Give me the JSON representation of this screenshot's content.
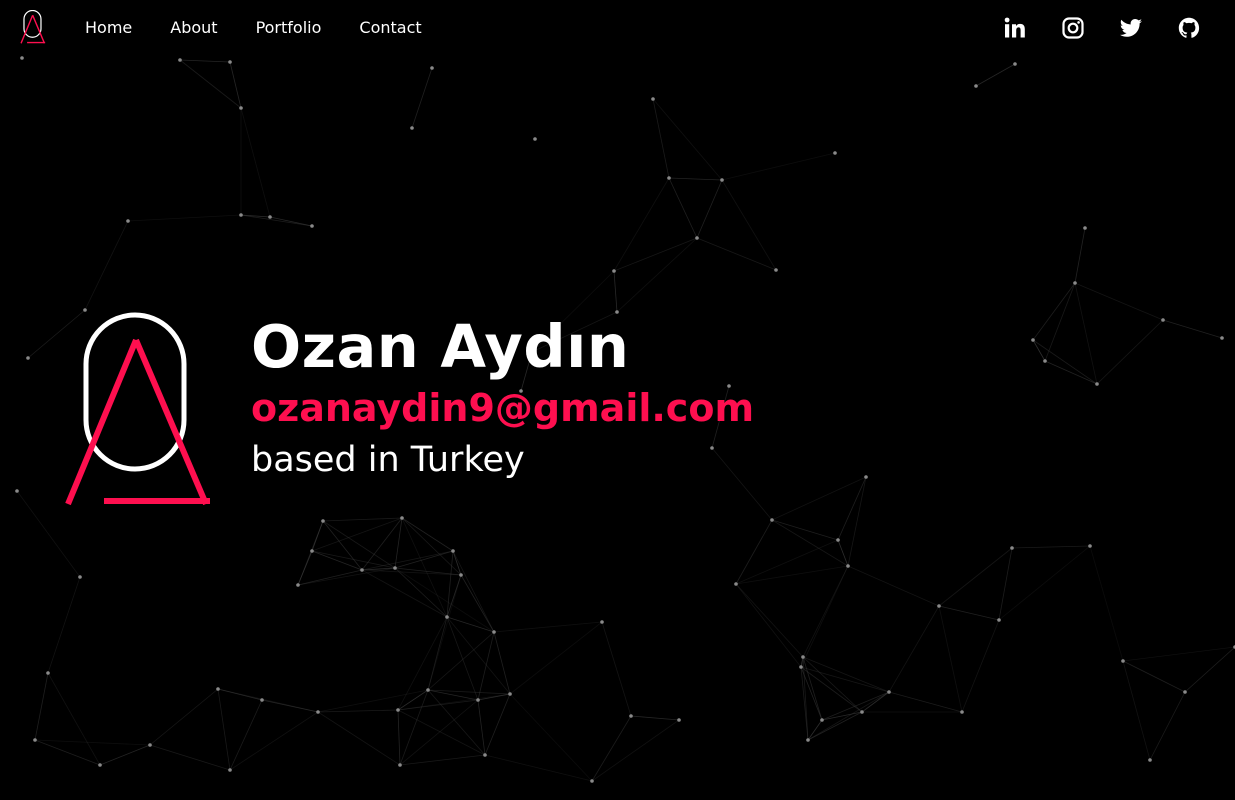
{
  "nav": {
    "logo_icon": "ozan-aydin-logo-icon",
    "links": [
      {
        "label": "Home"
      },
      {
        "label": "About"
      },
      {
        "label": "Portfolio"
      },
      {
        "label": "Contact"
      }
    ]
  },
  "social": [
    {
      "name": "linkedin",
      "icon": "linkedin-icon"
    },
    {
      "name": "instagram",
      "icon": "instagram-icon"
    },
    {
      "name": "twitter",
      "icon": "twitter-icon"
    },
    {
      "name": "github",
      "icon": "github-icon"
    }
  ],
  "hero": {
    "name": "Ozan Aydın",
    "email": "ozanaydin9@gmail.com",
    "location": "based in Turkey",
    "logo_icon": "ozan-aydin-logo-icon"
  },
  "colors": {
    "background": "#000000",
    "text": "#ffffff",
    "accent": "#fe0f4f",
    "network_line": "#3a3a3a",
    "network_node": "#8a8a8a"
  }
}
